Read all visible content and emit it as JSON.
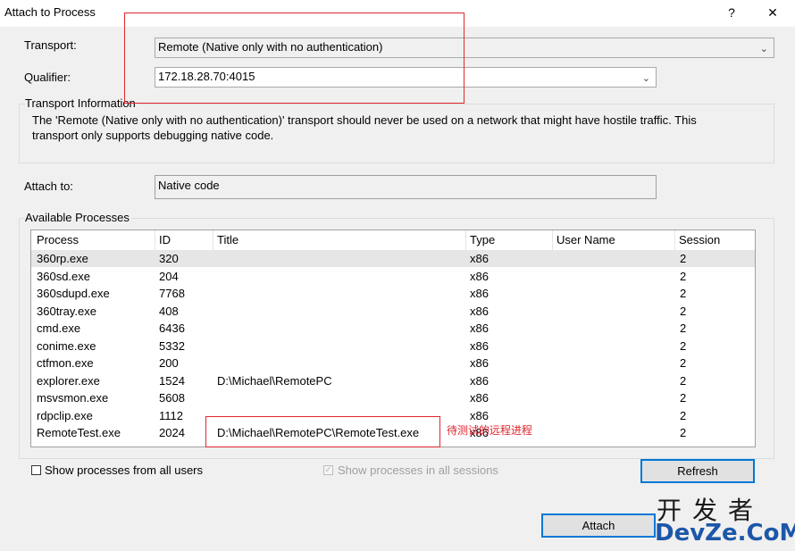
{
  "window": {
    "title": "Attach to Process",
    "help_glyph": "?",
    "close_glyph": "✕"
  },
  "transport": {
    "label": "Transport:",
    "value": "Remote (Native only with no authentication)"
  },
  "qualifier": {
    "label": "Qualifier:",
    "value": "172.18.28.70:4015"
  },
  "transport_info": {
    "legend": "Transport Information",
    "text_line1": "The 'Remote (Native only with no authentication)' transport should never be used on a network that might have hostile traffic. This",
    "text_line2": "transport only supports debugging native code."
  },
  "attach_to": {
    "label": "Attach to:",
    "value": "Native code"
  },
  "processes": {
    "legend": "Available Processes",
    "columns": [
      "Process",
      "ID",
      "Title",
      "Type",
      "User Name",
      "Session"
    ],
    "rows": [
      [
        "360rp.exe",
        "320",
        "",
        "x86",
        "",
        "2"
      ],
      [
        "360sd.exe",
        "204",
        "",
        "x86",
        "",
        "2"
      ],
      [
        "360sdupd.exe",
        "7768",
        "",
        "x86",
        "",
        "2"
      ],
      [
        "360tray.exe",
        "408",
        "",
        "x86",
        "",
        "2"
      ],
      [
        "cmd.exe",
        "6436",
        "",
        "x86",
        "",
        "2"
      ],
      [
        "conime.exe",
        "5332",
        "",
        "x86",
        "",
        "2"
      ],
      [
        "ctfmon.exe",
        "200",
        "",
        "x86",
        "",
        "2"
      ],
      [
        "explorer.exe",
        "1524",
        "D:\\Michael\\RemotePC",
        "x86",
        "",
        "2"
      ],
      [
        "msvsmon.exe",
        "5608",
        "",
        "x86",
        "",
        "2"
      ],
      [
        "rdpclip.exe",
        "1112",
        "",
        "x86",
        "",
        "2"
      ],
      [
        "RemoteTest.exe",
        "2024",
        "D:\\Michael\\RemotePC\\RemoteTest.exe",
        "x86",
        "",
        "2"
      ]
    ]
  },
  "annotation": {
    "text": "待测试的远程进程",
    "color": "#e0262e"
  },
  "options": {
    "show_all_users": "Show processes from all users",
    "show_all_sessions": "Show processes in all sessions",
    "show_all_sessions_checked": true
  },
  "buttons": {
    "refresh": "Refresh",
    "attach": "Attach"
  },
  "watermark": {
    "cn": "开发者",
    "en": "DevZe.CoM"
  },
  "colors": {
    "annotation_red": "#e0262e",
    "focus_blue": "#0078d7",
    "watermark_blue": "#1c57a8"
  }
}
